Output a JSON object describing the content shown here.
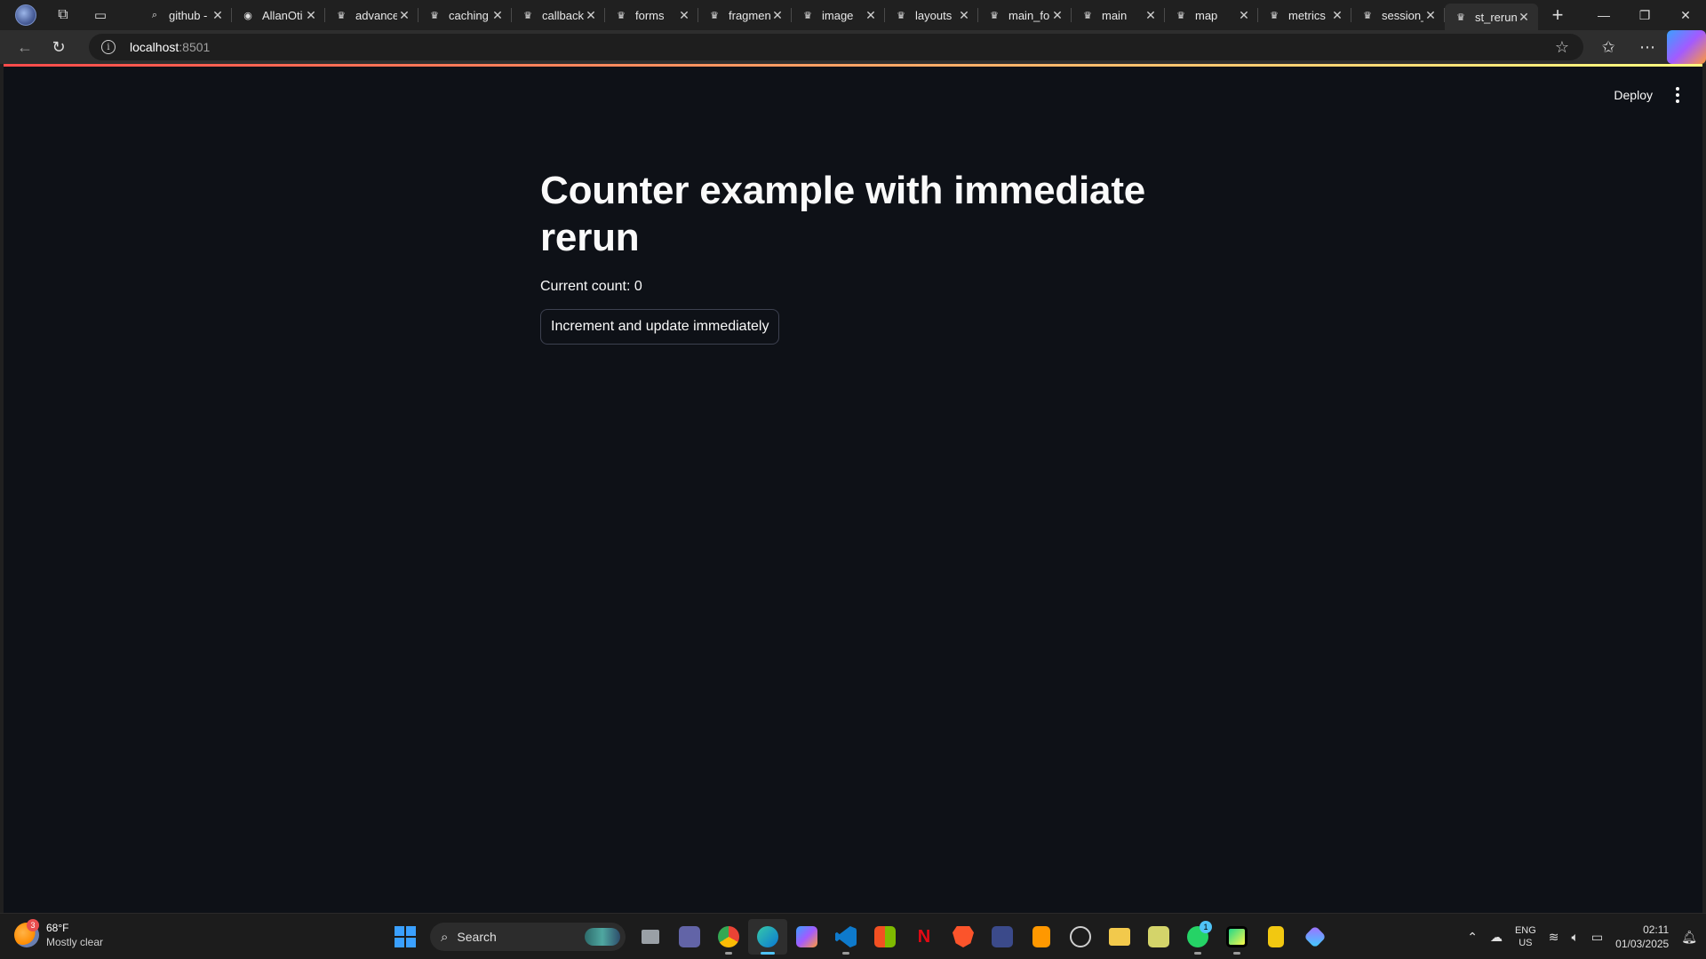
{
  "browser": {
    "tabs": [
      {
        "label": "github -",
        "icon": "search-icon"
      },
      {
        "label": "AllanOti",
        "icon": "github-icon"
      },
      {
        "label": "advance",
        "icon": "streamlit-icon"
      },
      {
        "label": "caching",
        "icon": "streamlit-icon"
      },
      {
        "label": "callback",
        "icon": "streamlit-icon"
      },
      {
        "label": "forms",
        "icon": "streamlit-icon"
      },
      {
        "label": "fragmen",
        "icon": "streamlit-icon"
      },
      {
        "label": "image",
        "icon": "streamlit-icon"
      },
      {
        "label": "layouts",
        "icon": "streamlit-icon"
      },
      {
        "label": "main_fo",
        "icon": "streamlit-icon"
      },
      {
        "label": "main",
        "icon": "streamlit-icon"
      },
      {
        "label": "map",
        "icon": "streamlit-icon"
      },
      {
        "label": "metrics",
        "icon": "streamlit-icon"
      },
      {
        "label": "session_",
        "icon": "streamlit-icon"
      },
      {
        "label": "st_rerun",
        "icon": "streamlit-icon",
        "active": true
      }
    ],
    "url_host": "localhost",
    "url_port": ":8501"
  },
  "app": {
    "deploy_label": "Deploy",
    "title": "Counter example with immediate rerun",
    "count_text": "Current count: 0",
    "button_label": "Increment and update immediately"
  },
  "taskbar": {
    "weather_temp": "68°F",
    "weather_condition": "Mostly clear",
    "weather_badge": "3",
    "search_placeholder": "Search",
    "whatsapp_badge": "1",
    "lang_top": "ENG",
    "lang_bottom": "US",
    "time": "02:11",
    "date": "01/03/2025"
  },
  "colors": {
    "page_bg": "#0e1117",
    "accent_red": "#ff4b4b",
    "accent_yellow": "#fffd80"
  }
}
